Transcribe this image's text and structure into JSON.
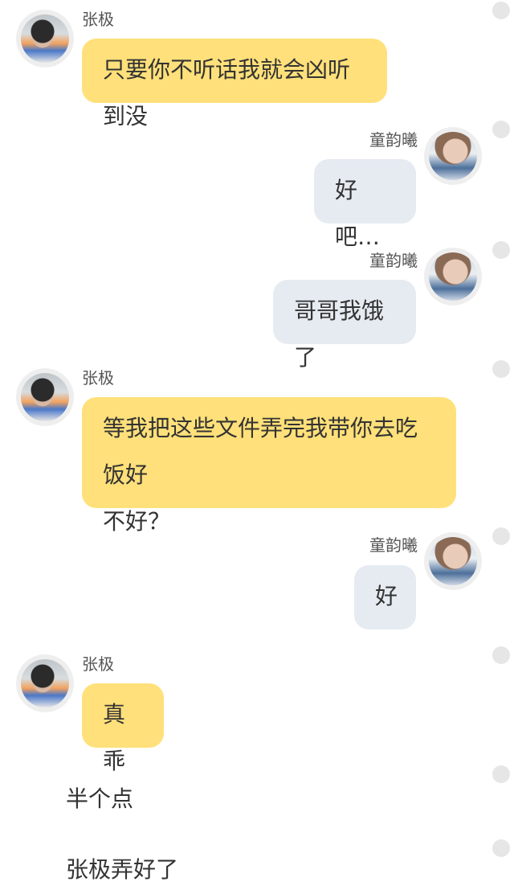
{
  "messages": [
    {
      "sender": "张极",
      "text": "只要你不听话我就会凶听到没"
    },
    {
      "sender": "童韵曦",
      "text": "好吧…"
    },
    {
      "sender": "童韵曦",
      "text": "哥哥我饿了"
    },
    {
      "sender": "张极",
      "text": "等我把这些文件弄完我带你去吃饭好不好？",
      "line1": "等我把这些文件弄完我带你去吃饭好",
      "line2": "不好？"
    },
    {
      "sender": "童韵曦",
      "text": "好"
    },
    {
      "sender": "张极",
      "text": "真乖"
    }
  ],
  "narration": [
    {
      "text": "半个点"
    },
    {
      "text": "张极弄好了"
    }
  ],
  "colors": {
    "bubble_left": "#ffe07a",
    "bubble_right": "#e6ebf2",
    "dot": "#e6e6e6"
  },
  "icons": {
    "avatar_left": "avatar-zhangji",
    "avatar_right": "avatar-tongyunxi",
    "menu_dot": "select-dot-icon"
  }
}
